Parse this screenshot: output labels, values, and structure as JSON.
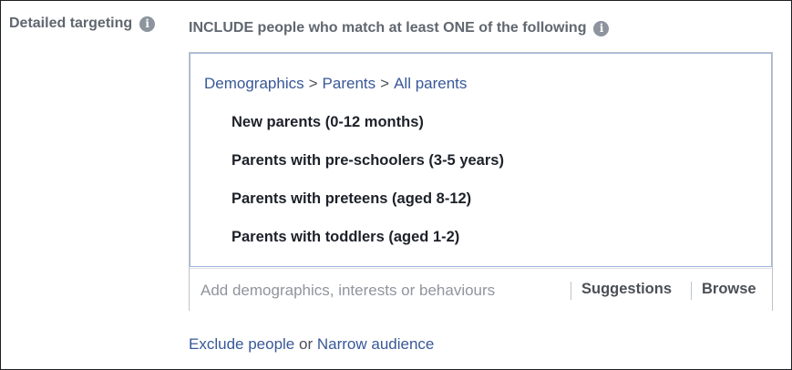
{
  "section_label": "Detailed targeting",
  "include_heading": {
    "strong1": "INCLUDE",
    "text1": " people who match at least ",
    "strong2": "ONE",
    "text2": " of the following"
  },
  "breadcrumb": [
    "Demographics",
    "Parents",
    "All parents"
  ],
  "breadcrumb_separator": ">",
  "targeting_items": [
    "New parents (0-12 months)",
    "Parents with pre-schoolers (3-5 years)",
    "Parents with preteens (aged 8-12)",
    "Parents with toddlers (aged 1-2)"
  ],
  "search": {
    "placeholder": "Add demographics, interests or behaviours"
  },
  "suggestions_label": "Suggestions",
  "browse_label": "Browse",
  "exclude_label": "Exclude people",
  "or_text": "or",
  "narrow_label": "Narrow audience",
  "icons": {
    "info": "info-icon"
  }
}
